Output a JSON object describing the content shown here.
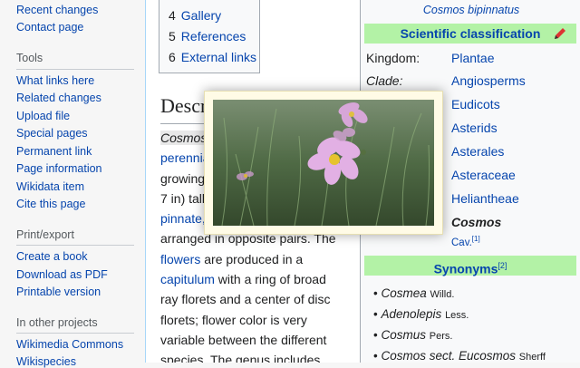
{
  "sidebar": {
    "items_top": [
      "Recent changes",
      "Contact page"
    ],
    "tools_heading": "Tools",
    "tools": [
      "What links here",
      "Related changes",
      "Upload file",
      "Special pages",
      "Permanent link",
      "Page information",
      "Wikidata item",
      "Cite this page"
    ],
    "print_heading": "Print/export",
    "print": [
      "Create a book",
      "Download as PDF",
      "Printable version"
    ],
    "projects_heading": "In other projects",
    "projects": [
      "Wikimedia Commons",
      "Wikispecies"
    ]
  },
  "toc": [
    {
      "num": "4",
      "label": "Gallery"
    },
    {
      "num": "5",
      "label": "References"
    },
    {
      "num": "6",
      "label": "External links"
    }
  ],
  "article": {
    "heading": "Descr",
    "lines": [
      {
        "pre": "",
        "link": "",
        "italic_hl": "Cosmos",
        "post": ""
      },
      {
        "pre": "",
        "link": "perennia",
        "italic_hl": "",
        "post": ""
      },
      {
        "pre": "growing",
        "link": "",
        "italic_hl": "",
        "post": ""
      },
      {
        "pre": "7 in) tall.",
        "link": "",
        "italic_hl": "",
        "post": ""
      },
      {
        "pre": "",
        "link": "pinnate,",
        "italic_hl": "",
        "post": ""
      },
      {
        "pre": "arranged in opposite pairs. The",
        "link": "",
        "italic_hl": "",
        "post": ""
      },
      {
        "pre": "",
        "link": "flowers",
        "italic_hl": "",
        "post": " are produced in a"
      },
      {
        "pre": "",
        "link": "capitulum",
        "italic_hl": "",
        "post": " with a ring of broad"
      },
      {
        "pre": "ray florets and a center of disc",
        "link": "",
        "italic_hl": "",
        "post": ""
      },
      {
        "pre": "florets; flower color is very",
        "link": "",
        "italic_hl": "",
        "post": ""
      },
      {
        "pre": "variable between the different",
        "link": "",
        "italic_hl": "",
        "post": ""
      },
      {
        "pre": "species. The genus includes",
        "link": "",
        "italic_hl": "",
        "post": ""
      }
    ]
  },
  "infobox": {
    "caption": "Cosmos bipinnatus",
    "classification_title": "Scientific classification",
    "taxonomy": [
      {
        "rank": "Kingdom:",
        "rank_italic": false,
        "value": "Plantae"
      },
      {
        "rank": "Clade:",
        "rank_italic": true,
        "value": "Angiosperms"
      },
      {
        "rank": "",
        "rank_italic": false,
        "value": "Eudicots"
      },
      {
        "rank": "",
        "rank_italic": false,
        "value": "Asterids"
      },
      {
        "rank": "",
        "rank_italic": false,
        "value": "Asterales"
      },
      {
        "rank": "",
        "rank_italic": false,
        "value": "Asteraceae"
      },
      {
        "rank": "",
        "rank_italic": false,
        "value": "Heliantheae"
      }
    ],
    "genus": "Cosmos",
    "authority": "Cav.",
    "authority_ref": "[1]",
    "synonyms_title": "Synonyms",
    "synonyms_ref": "[2]",
    "synonyms": [
      {
        "name": "Cosmea",
        "author": "Willd."
      },
      {
        "name": "Adenolepis",
        "author": "Less."
      },
      {
        "name": "Cosmus",
        "author": "Pers."
      },
      {
        "name": "Cosmos sect. Eucosmos",
        "author": "Sherff"
      }
    ]
  },
  "colors": {
    "link": "#0645ad",
    "taxobox_band": "#b3f2a6",
    "popup_bg": "#fffbe6"
  },
  "icons": {
    "edit": "pencil-icon",
    "bullet": "bullet-icon"
  }
}
